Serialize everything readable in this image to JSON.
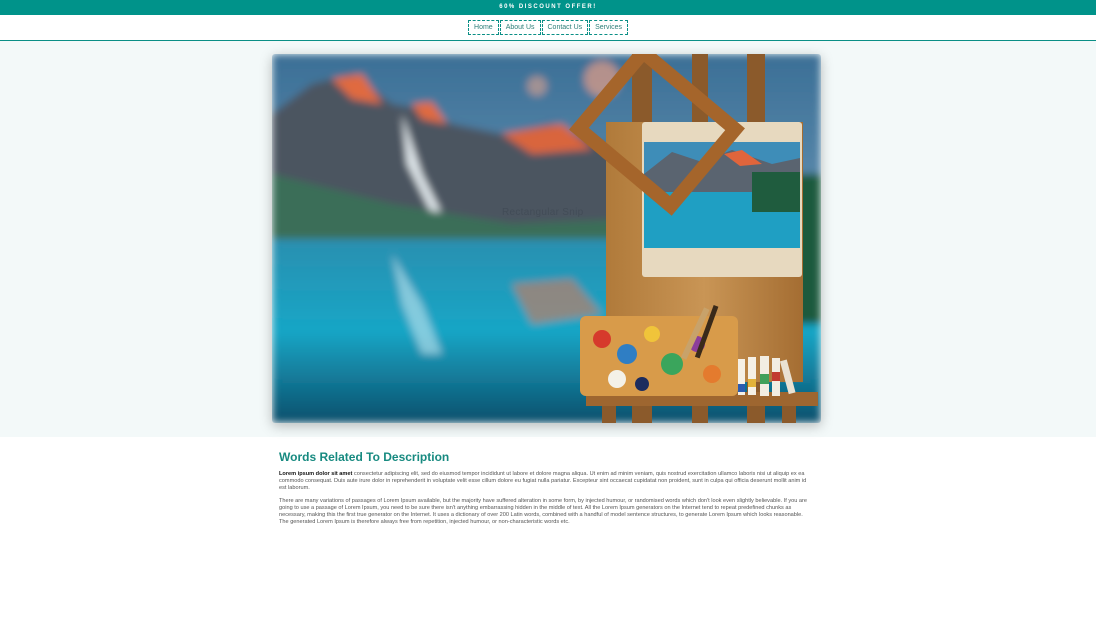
{
  "promo": {
    "text": "60% DISCOUNT OFFER!"
  },
  "nav": {
    "items": [
      {
        "label": "Home"
      },
      {
        "label": "About Us"
      },
      {
        "label": "Contact Us"
      },
      {
        "label": "Services"
      }
    ]
  },
  "hero": {
    "caption": "Rectangular Snip"
  },
  "section": {
    "title": "Words Related To Description",
    "para1_lead": "Lorem ipsum dolor sit amet",
    "para1_rest": " consectetur adipiscing elit, sed do eiusmod tempor incididunt ut labore et dolore magna aliqua. Ut enim ad minim veniam, quis nostrud exercitation ullamco laboris nisi ut aliquip ex ea commodo consequat. Duis aute irure dolor in reprehenderit in voluptate velit esse cillum dolore eu fugiat nulla pariatur. Excepteur sint occaecat cupidatat non proident, sunt in culpa qui officia deserunt mollit anim id est laborum.",
    "para2": "There are many variations of passages of Lorem Ipsum available, but the majority have suffered alteration in some form, by injected humour, or randomised words which don't look even slightly believable. If you are going to use a passage of Lorem Ipsum, you need to be sure there isn't anything embarrassing hidden in the middle of text. All the Lorem Ipsum generators on the Internet tend to repeat predefined chunks as necessary, making this the first true generator on the Internet. It uses a dictionary of over 200 Latin words, combined with a handful of model sentence structures, to generate Lorem Ipsum which looks reasonable. The generated Lorem Ipsum is therefore always free from repetition, injected humour, or non-characteristic words etc."
  },
  "colors": {
    "brand": "#00938a",
    "heading": "#178a80",
    "band": "#f3f9f9"
  }
}
